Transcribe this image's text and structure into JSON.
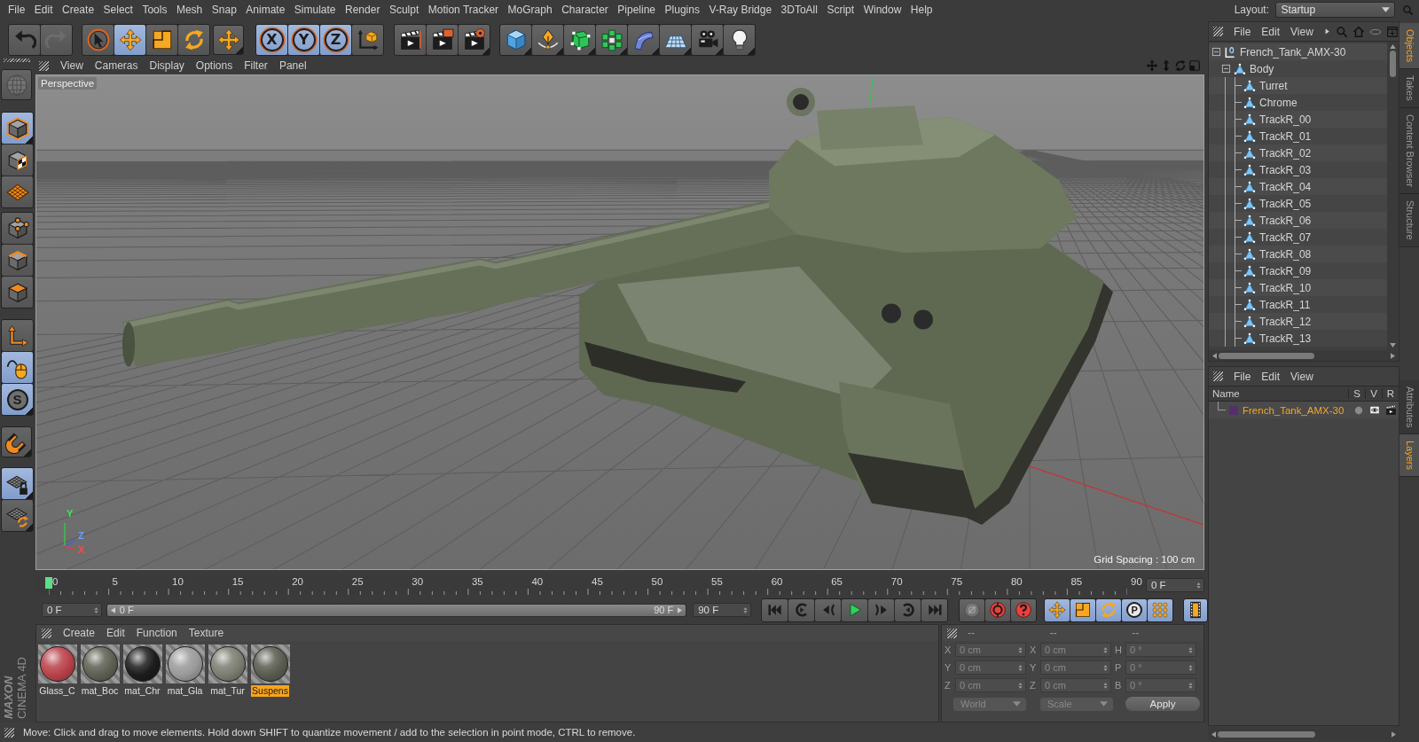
{
  "menu_bar": {
    "items": [
      "File",
      "Edit",
      "Create",
      "Select",
      "Tools",
      "Mesh",
      "Snap",
      "Animate",
      "Simulate",
      "Render",
      "Sculpt",
      "Motion Tracker",
      "MoGraph",
      "Character",
      "Pipeline",
      "Plugins",
      "V-Ray Bridge",
      "3DToAll",
      "Script",
      "Window",
      "Help"
    ],
    "layout_label": "Layout:",
    "layout_value": "Startup"
  },
  "toolbar": {
    "groups": [
      {
        "buttons": [
          {
            "selected": false,
            "disabled": false
          },
          {
            "selected": false,
            "disabled": true
          }
        ]
      },
      {
        "buttons": [
          {
            "selected": false,
            "disabled": false
          },
          {
            "selected": true,
            "disabled": false
          },
          {
            "selected": false,
            "disabled": false
          },
          {
            "selected": false,
            "disabled": false
          }
        ]
      },
      {
        "buttons": [
          {
            "selected": false,
            "disabled": false
          }
        ]
      },
      {
        "buttons": [
          {
            "label": "X",
            "selected": true,
            "disabled": false
          },
          {
            "label": "Y",
            "selected": true,
            "disabled": false
          },
          {
            "label": "Z",
            "selected": true,
            "disabled": false
          },
          {
            "selected": false,
            "disabled": false
          }
        ]
      },
      {
        "buttons": [
          {
            "selected": false,
            "disabled": false
          },
          {
            "selected": false,
            "disabled": false
          },
          {
            "selected": false,
            "disabled": false
          }
        ]
      },
      {
        "buttons": [
          {
            "selected": false,
            "disabled": false
          },
          {
            "selected": false,
            "disabled": false
          },
          {
            "selected": false,
            "disabled": false
          },
          {
            "selected": false,
            "disabled": false
          },
          {
            "selected": false,
            "disabled": false
          },
          {
            "selected": false,
            "disabled": false
          },
          {
            "selected": false,
            "disabled": false
          },
          {
            "selected": false,
            "disabled": false
          }
        ]
      }
    ]
  },
  "tool_palette": {
    "groups": [
      {
        "buttons": [
          {
            "selected": false,
            "disabled": true
          }
        ]
      },
      {
        "buttons": [
          {
            "selected": true,
            "disabled": false
          },
          {
            "selected": false,
            "disabled": false
          },
          {
            "selected": false,
            "disabled": false
          }
        ]
      },
      {
        "buttons": [
          {
            "selected": false,
            "disabled": false
          },
          {
            "selected": false,
            "disabled": false
          },
          {
            "selected": false,
            "disabled": false
          }
        ]
      },
      {
        "buttons": [
          {
            "selected": false,
            "disabled": false
          },
          {
            "selected": true,
            "disabled": false
          },
          {
            "label": "S",
            "selected": true,
            "disabled": false
          }
        ]
      },
      {
        "buttons": [
          {
            "selected": false,
            "disabled": false
          }
        ]
      },
      {
        "buttons": [
          {
            "selected": true,
            "disabled": false
          },
          {
            "selected": false,
            "disabled": false
          }
        ]
      }
    ]
  },
  "logo": {
    "brand": "MAXON",
    "product": "CINEMA 4D"
  },
  "viewport": {
    "menu": [
      "View",
      "Cameras",
      "Display",
      "Options",
      "Filter",
      "Panel"
    ],
    "camera": "Perspective",
    "grid_spacing": "Grid Spacing : 100 cm",
    "axis_labels": [
      {
        "text": "Y",
        "color": "#3ee856"
      },
      {
        "text": "Z",
        "color": "#6f9bff"
      },
      {
        "text": "X",
        "color": "#ff4a4a"
      }
    ]
  },
  "timeline": {
    "ticks": [
      "0",
      "5",
      "10",
      "15",
      "20",
      "25",
      "30",
      "35",
      "40",
      "45",
      "50",
      "55",
      "60",
      "65",
      "70",
      "75",
      "80",
      "85",
      "90"
    ],
    "level": 0,
    "frame_field": "0 F"
  },
  "transport": {
    "start_field": "0 F",
    "range": {
      "start": "0 F",
      "end": "90 F",
      "level": 1
    },
    "end_field": "90 F",
    "key_buttons": [
      {
        "disabled": true
      },
      {
        "disabled": false
      },
      {
        "disabled": false
      }
    ],
    "track_buttons": [
      {
        "selected": true
      },
      {
        "selected": true
      },
      {
        "selected": true
      },
      {
        "label": "P",
        "selected": true
      },
      {
        "selected": true
      }
    ],
    "timeline_button": {
      "selected": true
    }
  },
  "materials": {
    "menu": [
      "Create",
      "Edit",
      "Function",
      "Texture"
    ],
    "items": [
      {
        "name": "Glass_C",
        "color": "#b8424a",
        "selected": false
      },
      {
        "name": "mat_Boc",
        "color": "#5d6052",
        "selected": false
      },
      {
        "name": "mat_Chr",
        "color": "#1c1c1c",
        "selected": false
      },
      {
        "name": "mat_Gla",
        "color": "#9a9a9a",
        "selected": false
      },
      {
        "name": "mat_Tur",
        "color": "#7c7e72",
        "selected": false
      },
      {
        "name": "Suspens",
        "color": "#5a5c50",
        "selected": true
      }
    ]
  },
  "coordinates": {
    "headers": [
      "--",
      "--",
      "--"
    ],
    "rows": [
      {
        "fields": [
          {
            "axis": "X",
            "value": "0 cm"
          },
          {
            "axis": "X",
            "value": "0 cm"
          },
          {
            "axis": "H",
            "value": "0 °"
          }
        ]
      },
      {
        "fields": [
          {
            "axis": "Y",
            "value": "0 cm"
          },
          {
            "axis": "Y",
            "value": "0 cm"
          },
          {
            "axis": "P",
            "value": "0 °"
          }
        ]
      },
      {
        "fields": [
          {
            "axis": "Z",
            "value": "0 cm"
          },
          {
            "axis": "Z",
            "value": "0 cm"
          },
          {
            "axis": "B",
            "value": "0 °"
          }
        ]
      }
    ],
    "dropdowns": [
      "World",
      "Scale"
    ],
    "apply": "Apply"
  },
  "status_bar": "Move: Click and drag to move elements. Hold down SHIFT to quantize movement / add to the selection in point mode, CTRL to remove.",
  "objects_manager": {
    "menu": [
      "File",
      "Edit",
      "View"
    ],
    "tree": [
      {
        "name": "French_Tank_AMX-30",
        "kind": "null",
        "expanded": true,
        "children": [
          {
            "name": "Body",
            "kind": "polygon",
            "expanded": true,
            "children": [
              {
                "name": "Turret",
                "kind": "polygon"
              },
              {
                "name": "Chrome",
                "kind": "polygon"
              },
              {
                "name": "TrackR_00",
                "kind": "polygon"
              },
              {
                "name": "TrackR_01",
                "kind": "polygon"
              },
              {
                "name": "TrackR_02",
                "kind": "polygon"
              },
              {
                "name": "TrackR_03",
                "kind": "polygon"
              },
              {
                "name": "TrackR_04",
                "kind": "polygon"
              },
              {
                "name": "TrackR_05",
                "kind": "polygon"
              },
              {
                "name": "TrackR_06",
                "kind": "polygon"
              },
              {
                "name": "TrackR_07",
                "kind": "polygon"
              },
              {
                "name": "TrackR_08",
                "kind": "polygon"
              },
              {
                "name": "TrackR_09",
                "kind": "polygon"
              },
              {
                "name": "TrackR_10",
                "kind": "polygon"
              },
              {
                "name": "TrackR_11",
                "kind": "polygon"
              },
              {
                "name": "TrackR_12",
                "kind": "polygon"
              },
              {
                "name": "TrackR_13",
                "kind": "polygon"
              }
            ]
          }
        ]
      }
    ]
  },
  "layers_manager": {
    "menu": [
      "File",
      "Edit",
      "View"
    ],
    "columns": [
      "Name",
      "S",
      "V",
      "R"
    ],
    "rows": [
      {
        "name": "French_Tank_AMX-30",
        "color": "#54306a",
        "selected": true
      }
    ]
  },
  "side_tabs": {
    "top": [
      {
        "label": "Objects",
        "selected": true
      },
      {
        "label": "Takes",
        "selected": false
      },
      {
        "label": "Content Browser",
        "selected": false
      },
      {
        "label": "Structure",
        "selected": false
      }
    ],
    "bottom": [
      {
        "label": "Attributes",
        "selected": false
      },
      {
        "label": "Layers",
        "selected": true
      }
    ]
  }
}
